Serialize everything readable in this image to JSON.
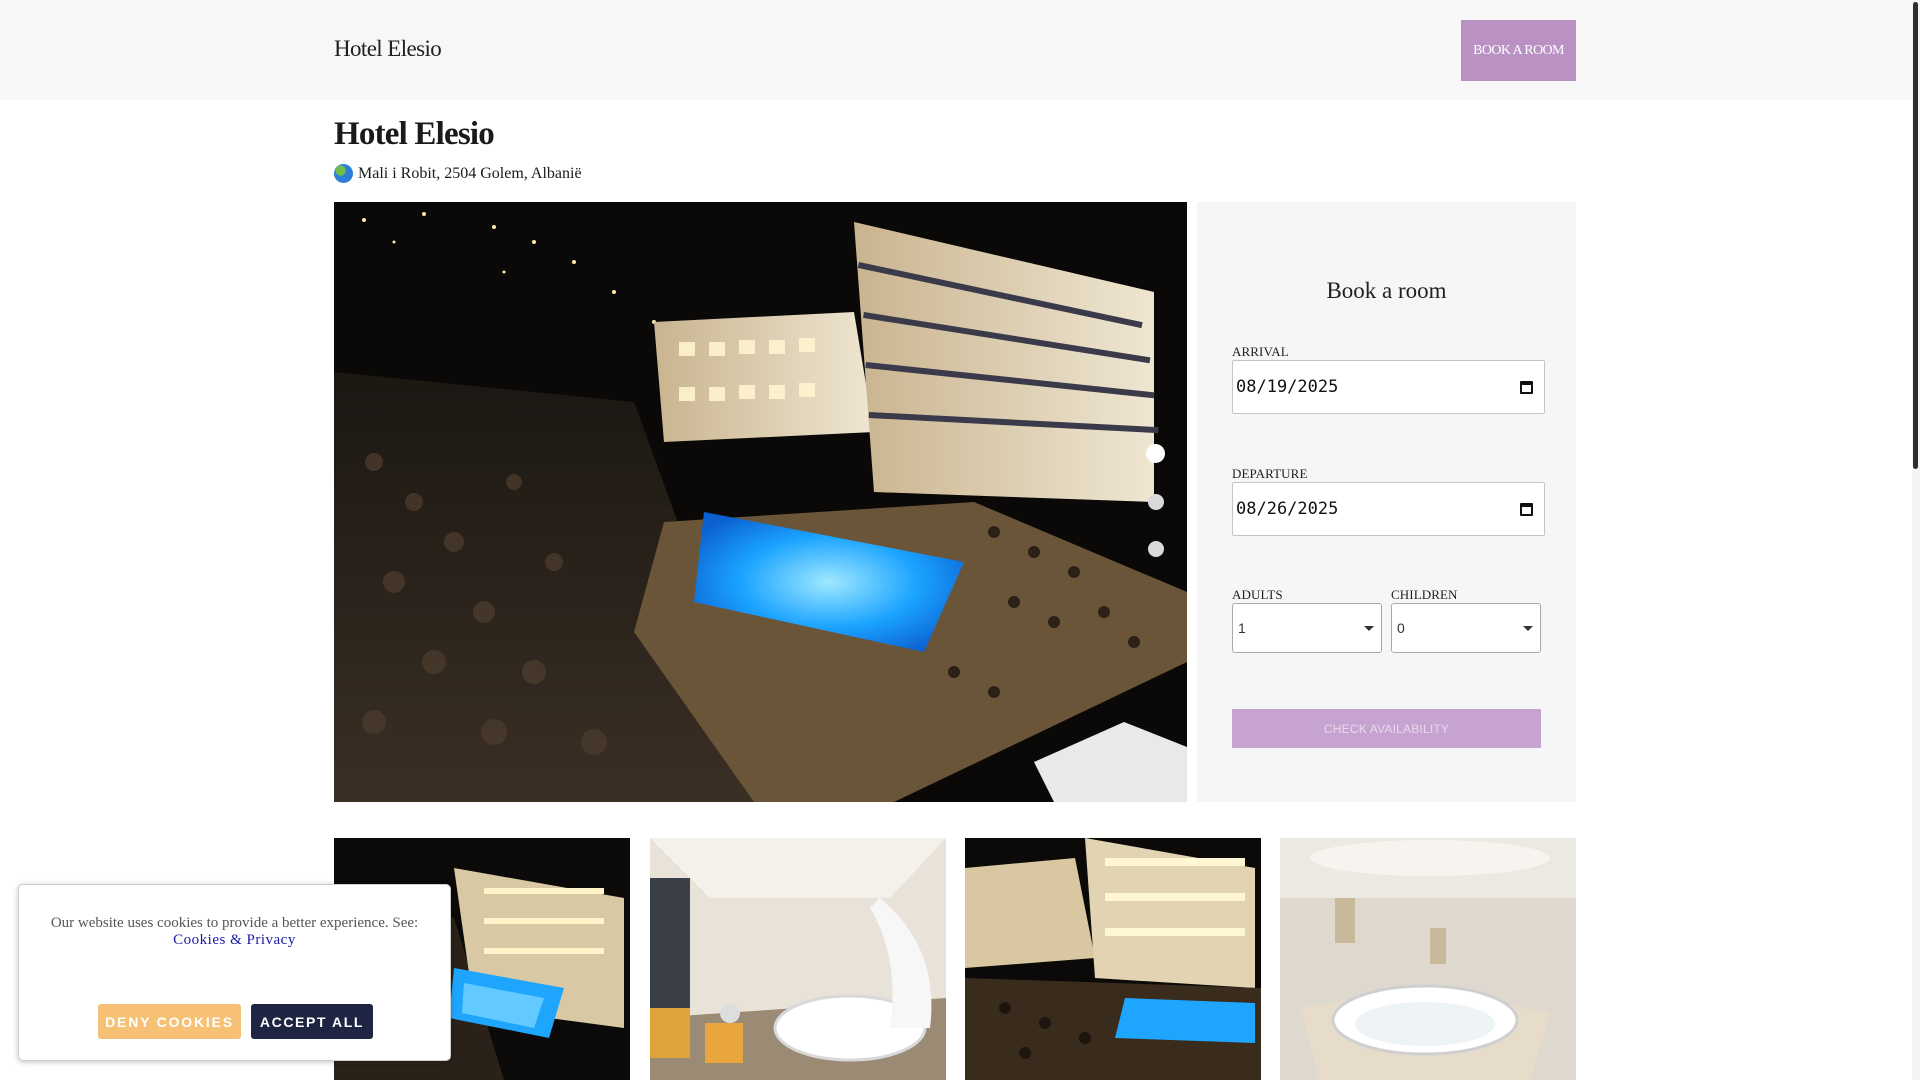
{
  "header": {
    "brand": "Hotel Elesio",
    "book_button": "BOOK A ROOM"
  },
  "hotel": {
    "name": "Hotel Elesio",
    "address_icon": "globe-icon",
    "address": "Mali i Robit, 2504 Golem, Albanië"
  },
  "slider": {
    "slide_count": 3,
    "active_slide": 1,
    "image": "aerial night view of hotel with illuminated pool"
  },
  "booking": {
    "title": "Book a room",
    "arrival_label": "ARRIVAL",
    "arrival_value": "08/19/2025",
    "departure_label": "DEPARTURE",
    "departure_value": "08/26/2025",
    "adults_label": "ADULTS",
    "adults_value": "1",
    "children_label": "CHILDREN",
    "children_value": "0",
    "check_button": "CHECK AVAILABILITY"
  },
  "gallery": [
    {
      "image": "hotel pool at night"
    },
    {
      "image": "bedroom with round bed"
    },
    {
      "image": "hotel building at night"
    },
    {
      "image": "jacuzzi bathroom"
    }
  ],
  "cookie_banner": {
    "text": "Our website uses cookies to provide a better experience. See:",
    "link": "Cookies & Privacy",
    "deny_button": "DENY COOKIES",
    "accept_button": "ACCEPT ALL"
  },
  "colors": {
    "accent": "#b992c3",
    "check_button": "#c7a3d2",
    "deny": "#f6c175",
    "accept": "#1e2542"
  }
}
